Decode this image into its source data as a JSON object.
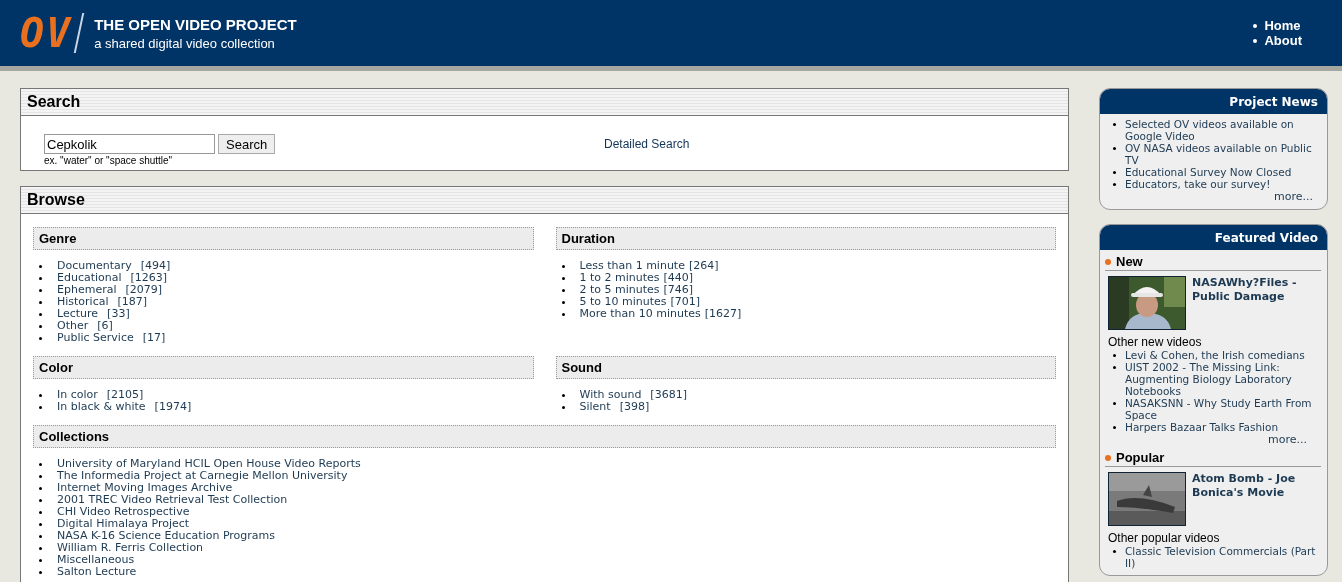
{
  "header": {
    "logo": "OV",
    "title": "THE OPEN VIDEO PROJECT",
    "subtitle": "a shared digital video collection",
    "nav": [
      "Home",
      "About"
    ]
  },
  "search": {
    "title": "Search",
    "value": "Cepkolik",
    "button": "Search",
    "hint": "ex. \"water\" or \"space shuttle\"",
    "detailed_link": "Detailed Search"
  },
  "browse": {
    "title": "Browse",
    "groups": [
      {
        "title": "Genre",
        "items": [
          {
            "label": "Documentary",
            "count": "[494]"
          },
          {
            "label": "Educational",
            "count": "[1263]"
          },
          {
            "label": "Ephemeral",
            "count": "[2079]"
          },
          {
            "label": "Historical",
            "count": "[187]"
          },
          {
            "label": "Lecture",
            "count": "[33]"
          },
          {
            "label": "Other",
            "count": "[6]"
          },
          {
            "label": "Public Service",
            "count": "[17]"
          }
        ]
      },
      {
        "title": "Duration",
        "items": [
          {
            "label": "Less than 1 minute",
            "count": "[264]"
          },
          {
            "label": "1 to 2 minutes",
            "count": "[440]"
          },
          {
            "label": "2 to 5 minutes",
            "count": "[746]"
          },
          {
            "label": "5 to 10 minutes",
            "count": "[701]"
          },
          {
            "label": "More than 10 minutes",
            "count": "[1627]"
          }
        ]
      },
      {
        "title": "Color",
        "items": [
          {
            "label": "In color",
            "count": "[2105]"
          },
          {
            "label": "In black & white",
            "count": "[1974]"
          }
        ]
      },
      {
        "title": "Sound",
        "items": [
          {
            "label": "With sound",
            "count": "[3681]"
          },
          {
            "label": "Silent",
            "count": "[398]"
          }
        ]
      }
    ],
    "collections": {
      "title": "Collections",
      "items": [
        "University of Maryland HCIL Open House Video Reports",
        "The Informedia Project at Carnegie Mellon University",
        "Internet Moving Images Archive",
        "2001 TREC Video Retrieval Test Collection",
        "CHI Video Retrospective",
        "Digital Himalaya Project",
        "NASA K-16 Science Education Programs",
        "William R. Ferris Collection",
        "Miscellaneous",
        "Salton Lecture"
      ]
    }
  },
  "news": {
    "title": "Project News",
    "items": [
      "Selected OV videos available on Google Video",
      "OV NASA videos available on Public TV",
      "Educational Survey Now Closed",
      "Educators, take our survey!"
    ],
    "more": "more..."
  },
  "featured": {
    "title": "Featured Video",
    "sections": [
      {
        "heading": "New",
        "video_title": "NASAWhy?Files - Public Damage",
        "other_heading": "Other new videos",
        "others": [
          "Levi & Cohen, the Irish comedians",
          "UIST 2002 - The Missing Link: Augmenting Biology Laboratory Notebooks",
          "NASAKSNN - Why Study Earth From Space",
          "Harpers Bazaar Talks Fashion"
        ],
        "more": "more..."
      },
      {
        "heading": "Popular",
        "video_title": "Atom Bomb - Joe Bonica's Movie",
        "other_heading": "Other popular videos",
        "others": [
          "Classic Television Commercials (Part II)"
        ]
      }
    ]
  }
}
